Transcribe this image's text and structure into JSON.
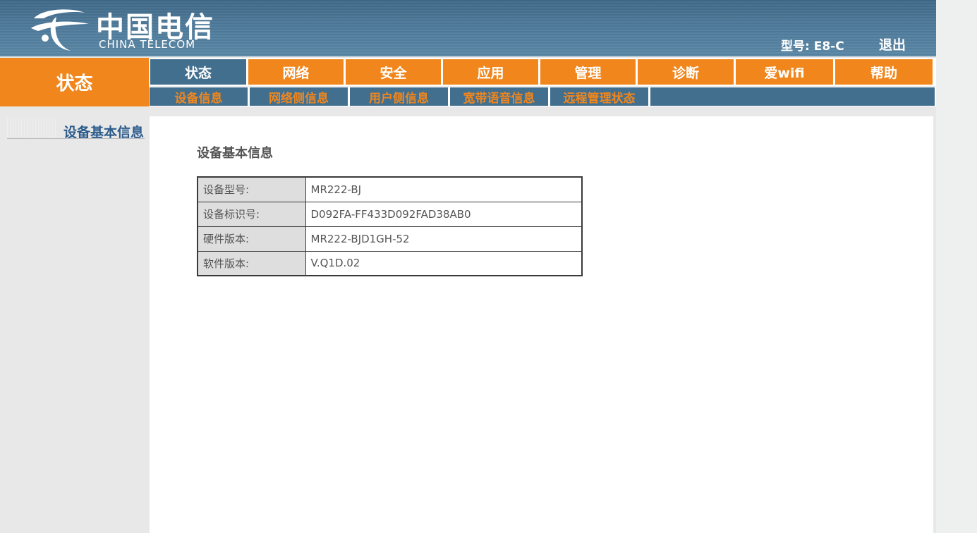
{
  "brand": {
    "name_cn": "中国电信",
    "name_en": "CHINA TELECOM"
  },
  "header": {
    "model_text": "型号: E8-C",
    "logout_label": "退出"
  },
  "section_title": "状态",
  "main_nav": [
    {
      "label": "状态",
      "active": true
    },
    {
      "label": "网络",
      "active": false
    },
    {
      "label": "安全",
      "active": false
    },
    {
      "label": "应用",
      "active": false
    },
    {
      "label": "管理",
      "active": false
    },
    {
      "label": "诊断",
      "active": false
    },
    {
      "label": "爱wifi",
      "active": false
    },
    {
      "label": "帮助",
      "active": false
    }
  ],
  "sub_nav": [
    {
      "label": "设备信息",
      "active": true
    },
    {
      "label": "网络侧信息",
      "active": false
    },
    {
      "label": "用户侧信息",
      "active": false
    },
    {
      "label": "宽带语音信息",
      "active": false
    },
    {
      "label": "远程管理状态",
      "active": false
    }
  ],
  "sidebar": {
    "items": [
      {
        "label": "设备基本信息"
      }
    ]
  },
  "content": {
    "title": "设备基本信息",
    "rows": [
      {
        "key": "设备型号:",
        "value": "MR222-BJ"
      },
      {
        "key": "设备标识号:",
        "value": "D092FA-FF433D092FAD38AB0"
      },
      {
        "key": "硬件版本:",
        "value": "MR222-BJD1GH-52"
      },
      {
        "key": "软件版本:",
        "value": "V.Q1D.02"
      }
    ]
  },
  "colors": {
    "orange": "#f0861c",
    "blue": "#436f8f",
    "link_blue": "#2d5c8c"
  }
}
